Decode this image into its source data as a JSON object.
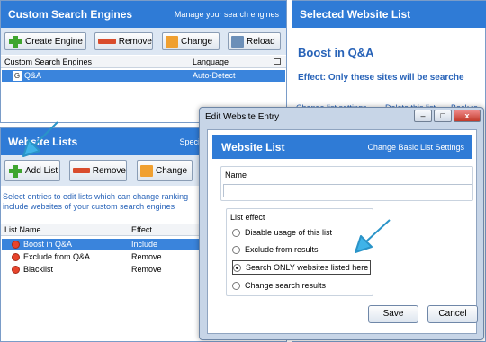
{
  "engines_panel": {
    "title": "Custom Search Engines",
    "subtitle": "Manage your search engines",
    "buttons": {
      "create": "Create Engine",
      "remove": "Remove",
      "change": "Change",
      "reload": "Reload"
    },
    "columns": {
      "name": "Custom Search Engines",
      "language": "Language"
    },
    "rows": [
      {
        "name": "Q&A",
        "language": "Auto-Detect",
        "selected": true
      }
    ]
  },
  "lists_panel": {
    "title": "Website Lists",
    "subtitle": "Speci",
    "buttons": {
      "add": "Add List",
      "remove": "Remove",
      "change": "Change"
    },
    "note": "Select entries to edit lists which can change ranking include websites of your custom search engines",
    "columns": {
      "name": "List Name",
      "effect": "Effect"
    },
    "rows": [
      {
        "name": "Boost in Q&A",
        "effect": "Include",
        "selected": true
      },
      {
        "name": "Exclude from Q&A",
        "effect": "Remove",
        "selected": false
      },
      {
        "name": "Blacklist",
        "effect": "Remove",
        "selected": false
      }
    ]
  },
  "selected_panel": {
    "title": "Selected Website List",
    "list_name": "Boost in Q&A",
    "effect_text": "Effect: Only these sites will be searche",
    "links": [
      "Change list settings",
      "Delete this list",
      "Back to"
    ]
  },
  "dialog": {
    "window_title": "Edit Website Entry",
    "header_title": "Website List",
    "header_link": "Change Basic List Settings",
    "name_label": "Name",
    "name_value": "",
    "group_label": "List effect",
    "options": [
      {
        "label": "Disable usage of this list",
        "checked": false
      },
      {
        "label": "Exclude from results",
        "checked": false
      },
      {
        "label": "Search ONLY websites listed here",
        "checked": true
      },
      {
        "label": "Change search results",
        "checked": false
      }
    ],
    "save": "Save",
    "cancel": "Cancel",
    "controls": {
      "minimize": "–",
      "maximize": "□",
      "close": "x"
    }
  },
  "colors": {
    "header_blue": "#2f7bd6",
    "selection": "#3a84dc",
    "arrow": "#3fb3e8"
  }
}
